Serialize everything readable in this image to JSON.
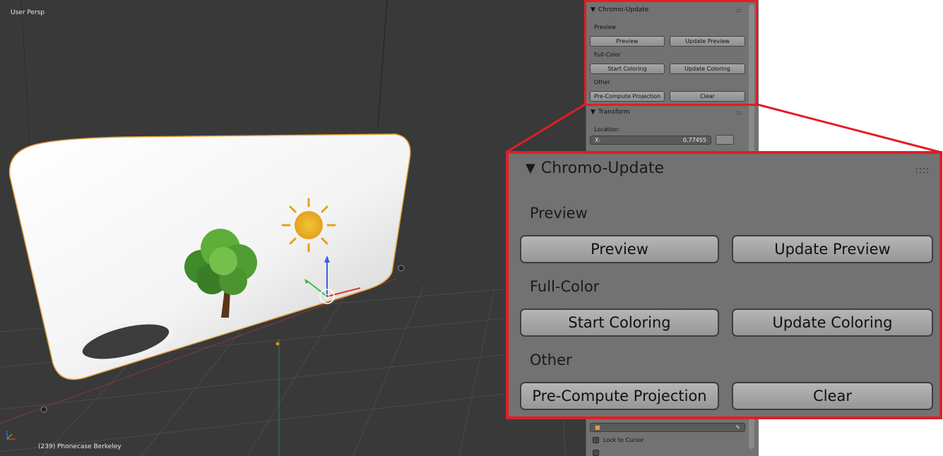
{
  "viewport": {
    "view_label": "User Persp",
    "status_text": "(239) Phonecase Berkeley"
  },
  "side_panel": {
    "chromo_title": "Chromo-Update",
    "preview_label": "Preview",
    "preview_button": "Preview",
    "update_preview_button": "Update Preview",
    "fullcolor_label": "Full-Color",
    "start_coloring_button": "Start Coloring",
    "update_coloring_button": "Update Coloring",
    "other_label": "Other",
    "precompute_button": "Pre-Compute Projection",
    "clear_button": "Clear",
    "transform_title": "Transform",
    "location_label": "Location:",
    "loc_x_label": "X:",
    "loc_x_value": "0.77455",
    "lock_to_cursor": "Lock to Cursor"
  },
  "callout": {
    "title": "Chromo-Update",
    "grip": "::::",
    "preview_label": "Preview",
    "preview_button": "Preview",
    "update_preview_button": "Update Preview",
    "fullcolor_label": "Full-Color",
    "start_coloring_button": "Start Coloring",
    "update_coloring_button": "Update Coloring",
    "other_label": "Other",
    "precompute_button": "Pre-Compute Projection",
    "clear_button": "Clear"
  },
  "colors": {
    "highlight": "#e21d25",
    "viewport_bg": "#393939",
    "panel_bg": "#727272"
  }
}
